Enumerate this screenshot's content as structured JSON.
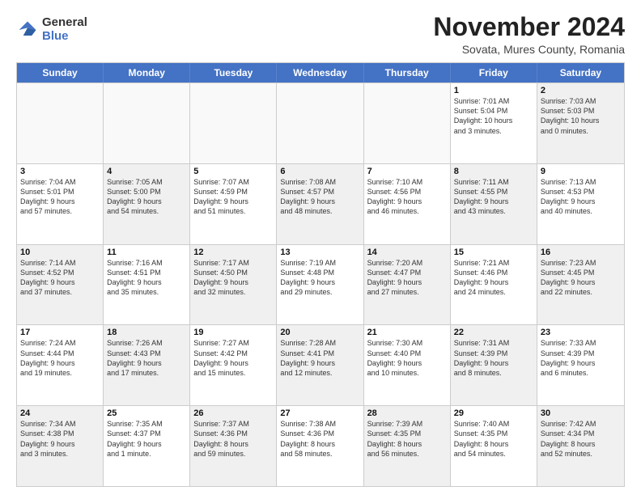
{
  "logo": {
    "general": "General",
    "blue": "Blue"
  },
  "title": "November 2024",
  "subtitle": "Sovata, Mures County, Romania",
  "header_days": [
    "Sunday",
    "Monday",
    "Tuesday",
    "Wednesday",
    "Thursday",
    "Friday",
    "Saturday"
  ],
  "rows": [
    [
      {
        "day": "",
        "info": "",
        "shaded": false,
        "empty": true
      },
      {
        "day": "",
        "info": "",
        "shaded": false,
        "empty": true
      },
      {
        "day": "",
        "info": "",
        "shaded": false,
        "empty": true
      },
      {
        "day": "",
        "info": "",
        "shaded": false,
        "empty": true
      },
      {
        "day": "",
        "info": "",
        "shaded": false,
        "empty": true
      },
      {
        "day": "1",
        "info": "Sunrise: 7:01 AM\nSunset: 5:04 PM\nDaylight: 10 hours\nand 3 minutes.",
        "shaded": false,
        "empty": false
      },
      {
        "day": "2",
        "info": "Sunrise: 7:03 AM\nSunset: 5:03 PM\nDaylight: 10 hours\nand 0 minutes.",
        "shaded": true,
        "empty": false
      }
    ],
    [
      {
        "day": "3",
        "info": "Sunrise: 7:04 AM\nSunset: 5:01 PM\nDaylight: 9 hours\nand 57 minutes.",
        "shaded": false,
        "empty": false
      },
      {
        "day": "4",
        "info": "Sunrise: 7:05 AM\nSunset: 5:00 PM\nDaylight: 9 hours\nand 54 minutes.",
        "shaded": true,
        "empty": false
      },
      {
        "day": "5",
        "info": "Sunrise: 7:07 AM\nSunset: 4:59 PM\nDaylight: 9 hours\nand 51 minutes.",
        "shaded": false,
        "empty": false
      },
      {
        "day": "6",
        "info": "Sunrise: 7:08 AM\nSunset: 4:57 PM\nDaylight: 9 hours\nand 48 minutes.",
        "shaded": true,
        "empty": false
      },
      {
        "day": "7",
        "info": "Sunrise: 7:10 AM\nSunset: 4:56 PM\nDaylight: 9 hours\nand 46 minutes.",
        "shaded": false,
        "empty": false
      },
      {
        "day": "8",
        "info": "Sunrise: 7:11 AM\nSunset: 4:55 PM\nDaylight: 9 hours\nand 43 minutes.",
        "shaded": true,
        "empty": false
      },
      {
        "day": "9",
        "info": "Sunrise: 7:13 AM\nSunset: 4:53 PM\nDaylight: 9 hours\nand 40 minutes.",
        "shaded": false,
        "empty": false
      }
    ],
    [
      {
        "day": "10",
        "info": "Sunrise: 7:14 AM\nSunset: 4:52 PM\nDaylight: 9 hours\nand 37 minutes.",
        "shaded": true,
        "empty": false
      },
      {
        "day": "11",
        "info": "Sunrise: 7:16 AM\nSunset: 4:51 PM\nDaylight: 9 hours\nand 35 minutes.",
        "shaded": false,
        "empty": false
      },
      {
        "day": "12",
        "info": "Sunrise: 7:17 AM\nSunset: 4:50 PM\nDaylight: 9 hours\nand 32 minutes.",
        "shaded": true,
        "empty": false
      },
      {
        "day": "13",
        "info": "Sunrise: 7:19 AM\nSunset: 4:48 PM\nDaylight: 9 hours\nand 29 minutes.",
        "shaded": false,
        "empty": false
      },
      {
        "day": "14",
        "info": "Sunrise: 7:20 AM\nSunset: 4:47 PM\nDaylight: 9 hours\nand 27 minutes.",
        "shaded": true,
        "empty": false
      },
      {
        "day": "15",
        "info": "Sunrise: 7:21 AM\nSunset: 4:46 PM\nDaylight: 9 hours\nand 24 minutes.",
        "shaded": false,
        "empty": false
      },
      {
        "day": "16",
        "info": "Sunrise: 7:23 AM\nSunset: 4:45 PM\nDaylight: 9 hours\nand 22 minutes.",
        "shaded": true,
        "empty": false
      }
    ],
    [
      {
        "day": "17",
        "info": "Sunrise: 7:24 AM\nSunset: 4:44 PM\nDaylight: 9 hours\nand 19 minutes.",
        "shaded": false,
        "empty": false
      },
      {
        "day": "18",
        "info": "Sunrise: 7:26 AM\nSunset: 4:43 PM\nDaylight: 9 hours\nand 17 minutes.",
        "shaded": true,
        "empty": false
      },
      {
        "day": "19",
        "info": "Sunrise: 7:27 AM\nSunset: 4:42 PM\nDaylight: 9 hours\nand 15 minutes.",
        "shaded": false,
        "empty": false
      },
      {
        "day": "20",
        "info": "Sunrise: 7:28 AM\nSunset: 4:41 PM\nDaylight: 9 hours\nand 12 minutes.",
        "shaded": true,
        "empty": false
      },
      {
        "day": "21",
        "info": "Sunrise: 7:30 AM\nSunset: 4:40 PM\nDaylight: 9 hours\nand 10 minutes.",
        "shaded": false,
        "empty": false
      },
      {
        "day": "22",
        "info": "Sunrise: 7:31 AM\nSunset: 4:39 PM\nDaylight: 9 hours\nand 8 minutes.",
        "shaded": true,
        "empty": false
      },
      {
        "day": "23",
        "info": "Sunrise: 7:33 AM\nSunset: 4:39 PM\nDaylight: 9 hours\nand 6 minutes.",
        "shaded": false,
        "empty": false
      }
    ],
    [
      {
        "day": "24",
        "info": "Sunrise: 7:34 AM\nSunset: 4:38 PM\nDaylight: 9 hours\nand 3 minutes.",
        "shaded": true,
        "empty": false
      },
      {
        "day": "25",
        "info": "Sunrise: 7:35 AM\nSunset: 4:37 PM\nDaylight: 9 hours\nand 1 minute.",
        "shaded": false,
        "empty": false
      },
      {
        "day": "26",
        "info": "Sunrise: 7:37 AM\nSunset: 4:36 PM\nDaylight: 8 hours\nand 59 minutes.",
        "shaded": true,
        "empty": false
      },
      {
        "day": "27",
        "info": "Sunrise: 7:38 AM\nSunset: 4:36 PM\nDaylight: 8 hours\nand 58 minutes.",
        "shaded": false,
        "empty": false
      },
      {
        "day": "28",
        "info": "Sunrise: 7:39 AM\nSunset: 4:35 PM\nDaylight: 8 hours\nand 56 minutes.",
        "shaded": true,
        "empty": false
      },
      {
        "day": "29",
        "info": "Sunrise: 7:40 AM\nSunset: 4:35 PM\nDaylight: 8 hours\nand 54 minutes.",
        "shaded": false,
        "empty": false
      },
      {
        "day": "30",
        "info": "Sunrise: 7:42 AM\nSunset: 4:34 PM\nDaylight: 8 hours\nand 52 minutes.",
        "shaded": true,
        "empty": false
      }
    ]
  ]
}
